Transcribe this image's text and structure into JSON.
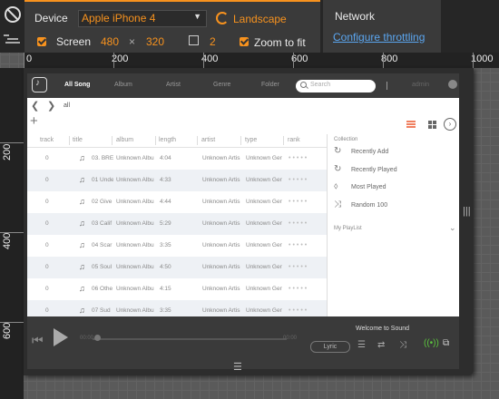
{
  "toolbar": {
    "device_label": "Device",
    "device_value": "Apple iPhone 4",
    "landscape_label": "Landscape",
    "screen_label": "Screen",
    "screen_width": "480",
    "screen_times": "×",
    "screen_height": "320",
    "scale_value": "2",
    "zoom_label": "Zoom to fit",
    "network_label": "Network",
    "throttle_link": "Configure throttling",
    "accent_color": "#f7921e"
  },
  "ruler": {
    "top": [
      "0",
      "200",
      "400",
      "600",
      "800",
      "1000"
    ],
    "left": [
      "200",
      "400",
      "600"
    ]
  },
  "app": {
    "nav": {
      "items": [
        "All Song",
        "Album",
        "Artist",
        "Genre",
        "Folder"
      ],
      "search_placeholder": "Search",
      "user": "admin"
    },
    "breadcrumb": "all",
    "table": {
      "columns": [
        "track",
        "title",
        "album",
        "length",
        "artist",
        "type",
        "rank"
      ],
      "rows": [
        {
          "track": "0",
          "title": "03. BRE",
          "album": "Unknown Albu",
          "length": "4:04",
          "artist": "Unknown Artis",
          "type": "Unknown Ger"
        },
        {
          "track": "0",
          "title": "01 Unde",
          "album": "Unknown Albu",
          "length": "4:33",
          "artist": "Unknown Artis",
          "type": "Unknown Ger"
        },
        {
          "track": "0",
          "title": "02 Give",
          "album": "Unknown Albu",
          "length": "4:44",
          "artist": "Unknown Artis",
          "type": "Unknown Ger"
        },
        {
          "track": "0",
          "title": "03 Calif",
          "album": "Unknown Albu",
          "length": "5:29",
          "artist": "Unknown Artis",
          "type": "Unknown Ger"
        },
        {
          "track": "0",
          "title": "04 Scar",
          "album": "Unknown Albu",
          "length": "3:35",
          "artist": "Unknown Artis",
          "type": "Unknown Ger"
        },
        {
          "track": "0",
          "title": "05 Soul",
          "album": "Unknown Albu",
          "length": "4:50",
          "artist": "Unknown Artis",
          "type": "Unknown Ger"
        },
        {
          "track": "0",
          "title": "06 Othe",
          "album": "Unknown Albu",
          "length": "4:15",
          "artist": "Unknown Artis",
          "type": "Unknown Ger"
        },
        {
          "track": "0",
          "title": "07 Sud",
          "album": "Unknown Albu",
          "length": "3:35",
          "artist": "Unknown Artis",
          "type": "Unknown Ger"
        }
      ]
    },
    "collection": {
      "title": "Collection",
      "items": [
        "Recently Add",
        "Recently Played",
        "Most Played",
        "Random 100"
      ],
      "playlist_title": "My PlayList"
    },
    "player": {
      "now_playing": "Welcome to Sound",
      "time_start": "00:00",
      "time_end": "00:00",
      "lyric_label": "Lyric"
    }
  }
}
